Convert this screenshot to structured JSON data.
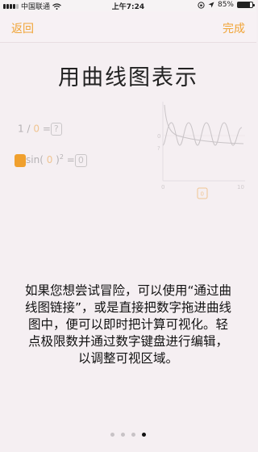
{
  "status_bar": {
    "carrier": "中国联通",
    "time": "上午7:24",
    "battery": "85%",
    "battery_level": 0.85
  },
  "nav": {
    "back_label": "返回",
    "done_label": "完成",
    "accent_color": "#f0a436"
  },
  "title": "用曲线图表示",
  "illustration": {
    "expr1": {
      "numerator": "1",
      "operator": "/",
      "denominator": "0",
      "equals": "=",
      "result": "?"
    },
    "expr2": {
      "func": "sin(",
      "arg": "0",
      "close": ")",
      "power": "2",
      "equals": "=",
      "result": "0"
    },
    "graph": {
      "y_label": "0",
      "y_mark": "?",
      "x_min": "0",
      "x_max": "10",
      "value_box": "0"
    }
  },
  "description": "如果您想尝试冒险，可以使用“通过曲线图链接”，或是直接把数字拖进曲线图中，便可以即时把计算可视化。轻点极限数并通过数字键盘进行编辑，以调整可视区域。",
  "pagination": {
    "count": 4,
    "active_index": 3
  }
}
